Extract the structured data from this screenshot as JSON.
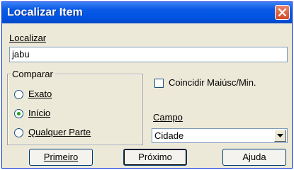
{
  "window": {
    "title": "Localizar Item"
  },
  "search": {
    "label": "Localizar",
    "value": "jabu"
  },
  "compare": {
    "title": "Comparar",
    "options": [
      {
        "label": "Exato",
        "checked": false
      },
      {
        "label": "Início",
        "checked": true
      },
      {
        "label": "Qualquer Parte",
        "checked": false
      }
    ]
  },
  "match_case": {
    "label": "Coincidir Maiúsc/Min.",
    "checked": false
  },
  "field": {
    "label": "Campo",
    "value": "Cidade"
  },
  "buttons": {
    "first": "Primeiro",
    "next": "Próximo",
    "help": "Ajuda"
  },
  "colors": {
    "titlebar": "#0054e3",
    "window": "#ece9d8",
    "radio_dot": "#21a121"
  }
}
